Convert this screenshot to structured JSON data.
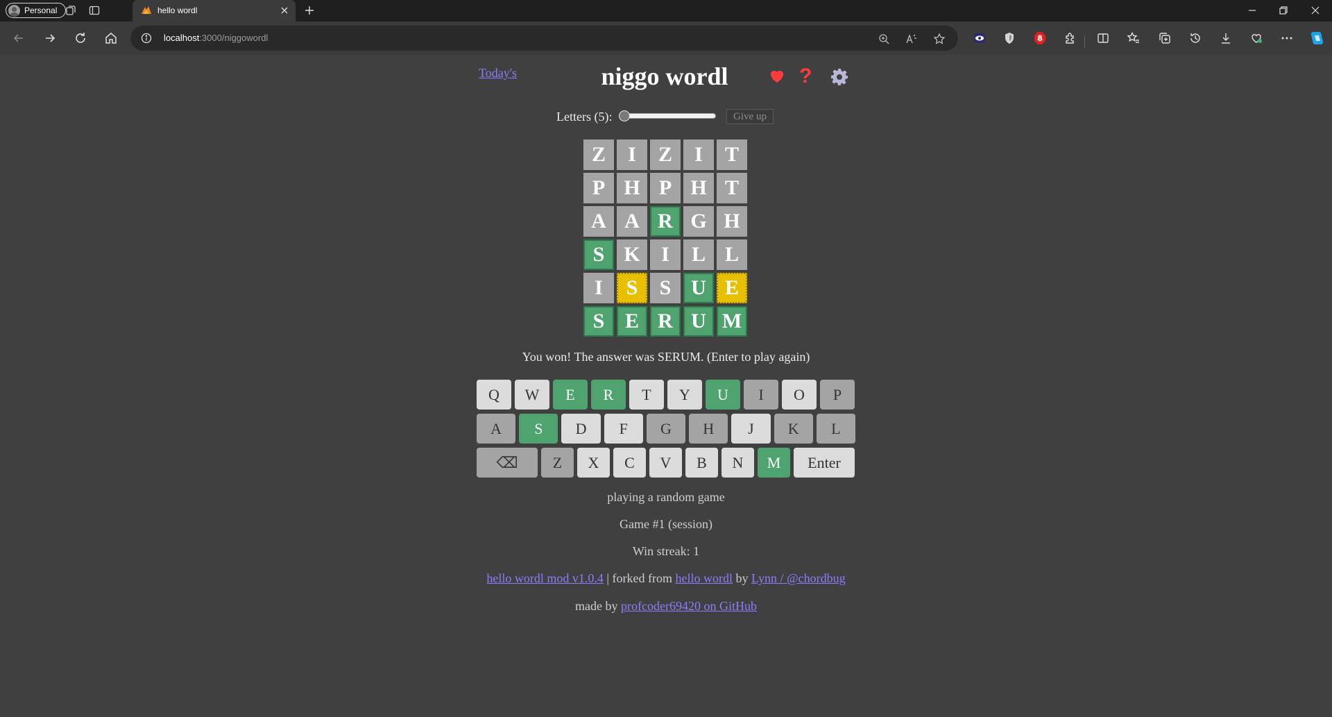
{
  "browser": {
    "profile_label": "Personal",
    "tab_title": "hello wordl",
    "url_host": "localhost",
    "url_path": ":3000/niggowordl"
  },
  "game": {
    "today_link": "Today's",
    "title": "niggo wordl",
    "help_glyph": "?",
    "letters_label": "Letters (5):",
    "letters_count": 5,
    "letters_slider_fraction": 0.0,
    "give_up_label": "Give up",
    "board": [
      [
        [
          "Z",
          "absent"
        ],
        [
          "I",
          "absent"
        ],
        [
          "Z",
          "absent"
        ],
        [
          "I",
          "absent"
        ],
        [
          "T",
          "absent"
        ]
      ],
      [
        [
          "P",
          "absent"
        ],
        [
          "H",
          "absent"
        ],
        [
          "P",
          "absent"
        ],
        [
          "H",
          "absent"
        ],
        [
          "T",
          "absent"
        ]
      ],
      [
        [
          "A",
          "absent"
        ],
        [
          "A",
          "absent"
        ],
        [
          "R",
          "correct"
        ],
        [
          "G",
          "absent"
        ],
        [
          "H",
          "absent"
        ]
      ],
      [
        [
          "S",
          "correct"
        ],
        [
          "K",
          "absent"
        ],
        [
          "I",
          "absent"
        ],
        [
          "L",
          "absent"
        ],
        [
          "L",
          "absent"
        ]
      ],
      [
        [
          "I",
          "absent"
        ],
        [
          "S",
          "present"
        ],
        [
          "S",
          "absent"
        ],
        [
          "U",
          "correct"
        ],
        [
          "E",
          "present"
        ]
      ],
      [
        [
          "S",
          "correct"
        ],
        [
          "E",
          "correct"
        ],
        [
          "R",
          "correct"
        ],
        [
          "U",
          "correct"
        ],
        [
          "M",
          "correct"
        ]
      ]
    ],
    "message": "You won! The answer was SERUM. (Enter to play again)",
    "keyboard": [
      [
        [
          "Q",
          "unused"
        ],
        [
          "W",
          "unused"
        ],
        [
          "E",
          "correct"
        ],
        [
          "R",
          "correct"
        ],
        [
          "T",
          "unused"
        ],
        [
          "Y",
          "unused"
        ],
        [
          "U",
          "correct"
        ],
        [
          "I",
          "absent"
        ],
        [
          "O",
          "unused"
        ],
        [
          "P",
          "absent"
        ]
      ],
      [
        [
          "A",
          "absent"
        ],
        [
          "S",
          "correct"
        ],
        [
          "D",
          "unused"
        ],
        [
          "F",
          "unused"
        ],
        [
          "G",
          "absent"
        ],
        [
          "H",
          "absent"
        ],
        [
          "J",
          "unused"
        ],
        [
          "K",
          "absent"
        ],
        [
          "L",
          "absent"
        ]
      ],
      [
        [
          "⌫",
          "absent"
        ],
        [
          "Z",
          "absent"
        ],
        [
          "X",
          "unused"
        ],
        [
          "C",
          "unused"
        ],
        [
          "V",
          "unused"
        ],
        [
          "B",
          "unused"
        ],
        [
          "N",
          "unused"
        ],
        [
          "M",
          "correct"
        ],
        [
          "Enter",
          "unused"
        ]
      ]
    ],
    "mode_text": "playing a random game",
    "game_number_text": "Game #1 (session)",
    "win_streak_text": "Win streak: 1",
    "footer": {
      "mod_link": "hello wordl mod v1.0.4",
      "sep1": " | forked from ",
      "fork_link": "hello wordl",
      "by_text": " by ",
      "author_link": "Lynn / @chordbug",
      "made_by_text": "made by ",
      "made_by_link": "profcoder69420 on GitHub"
    }
  },
  "colors": {
    "correct": "#4ea36e",
    "present": "#e8c000",
    "absent": "#a4a4a4",
    "unused": "#dcdcdc",
    "background": "#404040",
    "link": "#8a7dff"
  }
}
